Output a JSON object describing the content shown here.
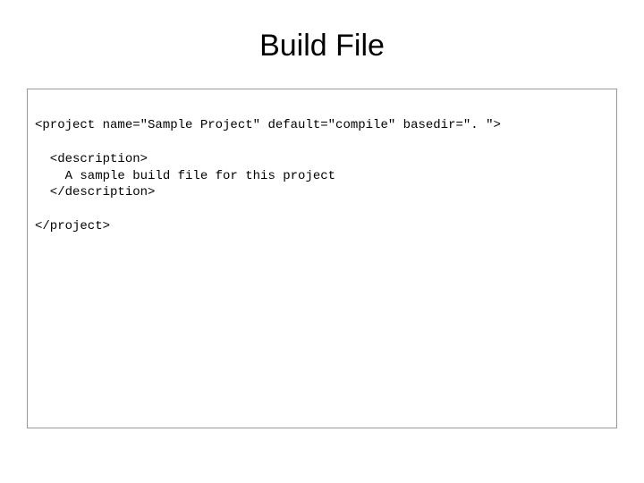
{
  "title": "Build File",
  "code": {
    "line1": "<project name=\"Sample Project\" default=\"compile\" basedir=\". \">",
    "line2": "",
    "line3": "  <description>",
    "line4": "    A sample build file for this project",
    "line5": "  </description>",
    "line6": "",
    "line7": "</project>"
  }
}
